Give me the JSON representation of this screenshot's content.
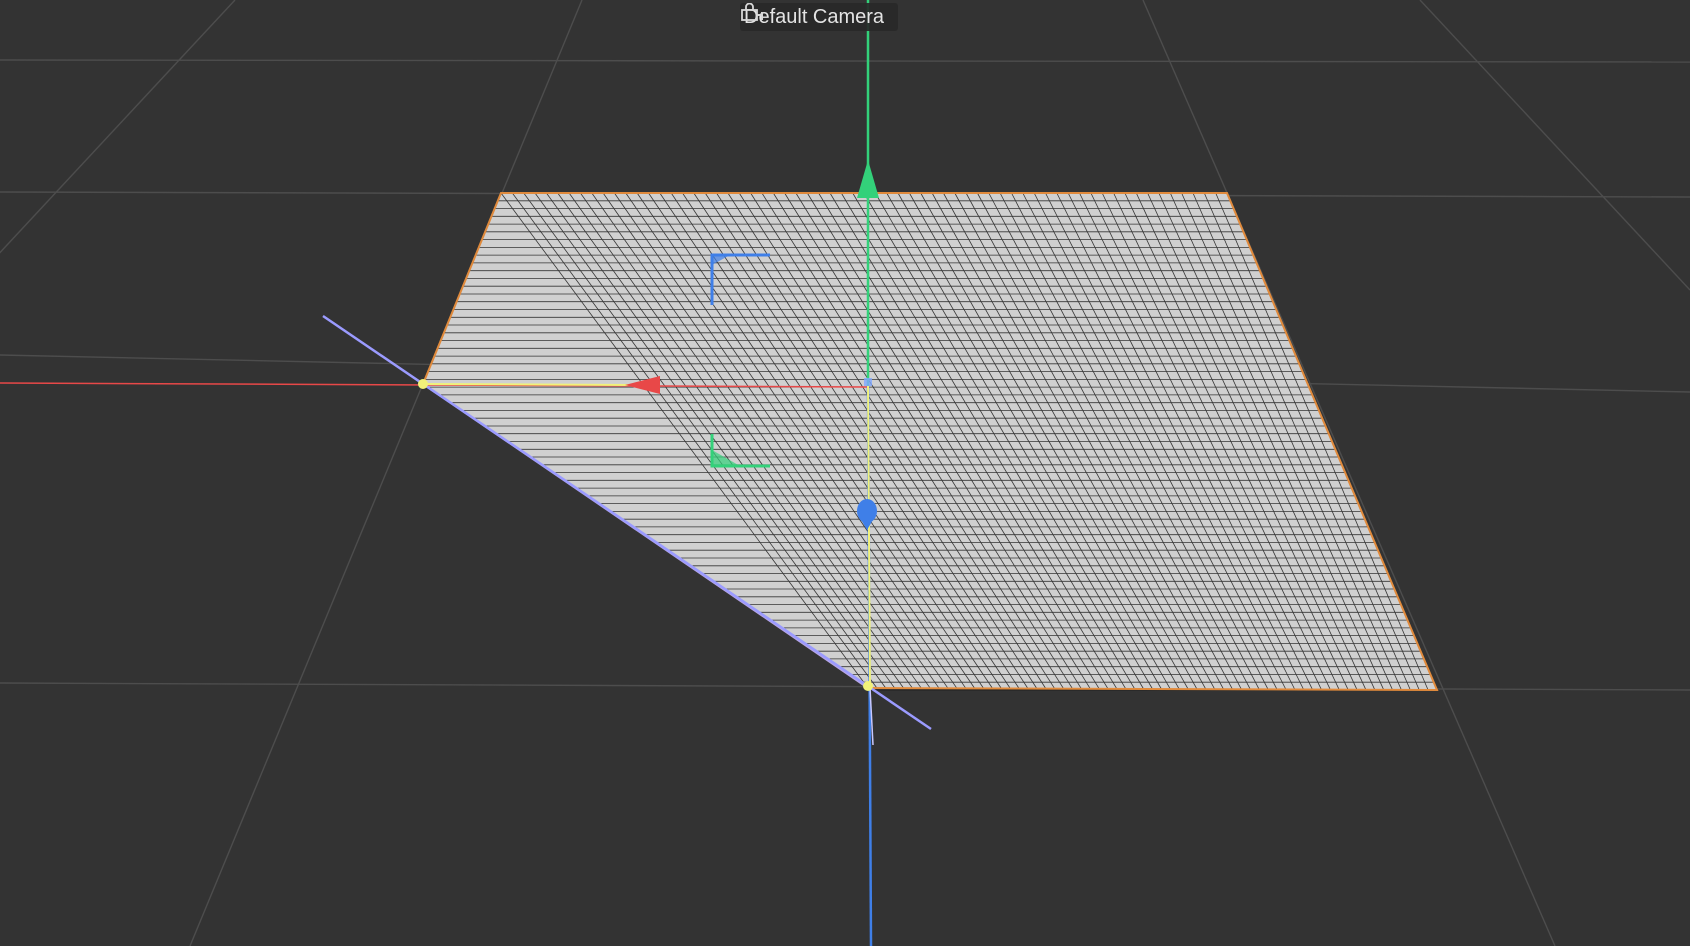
{
  "viewport": {
    "camera_label": "Default Camera",
    "camera_icon": "camera-lock-icon",
    "background_color": "#333333",
    "floor_grid_color": "#4d4d4d",
    "plane_fill_color": "#d0d0d0",
    "plane_wire_color": "#1a1a1a",
    "plane_outline_color": "#e08a3c",
    "axis_x_color": "#e84848",
    "axis_y_color": "#33d17a",
    "axis_z_color": "#3f7fe8",
    "selection_color": "#f1f17a",
    "axis_guide_color": "#9b9bff"
  }
}
